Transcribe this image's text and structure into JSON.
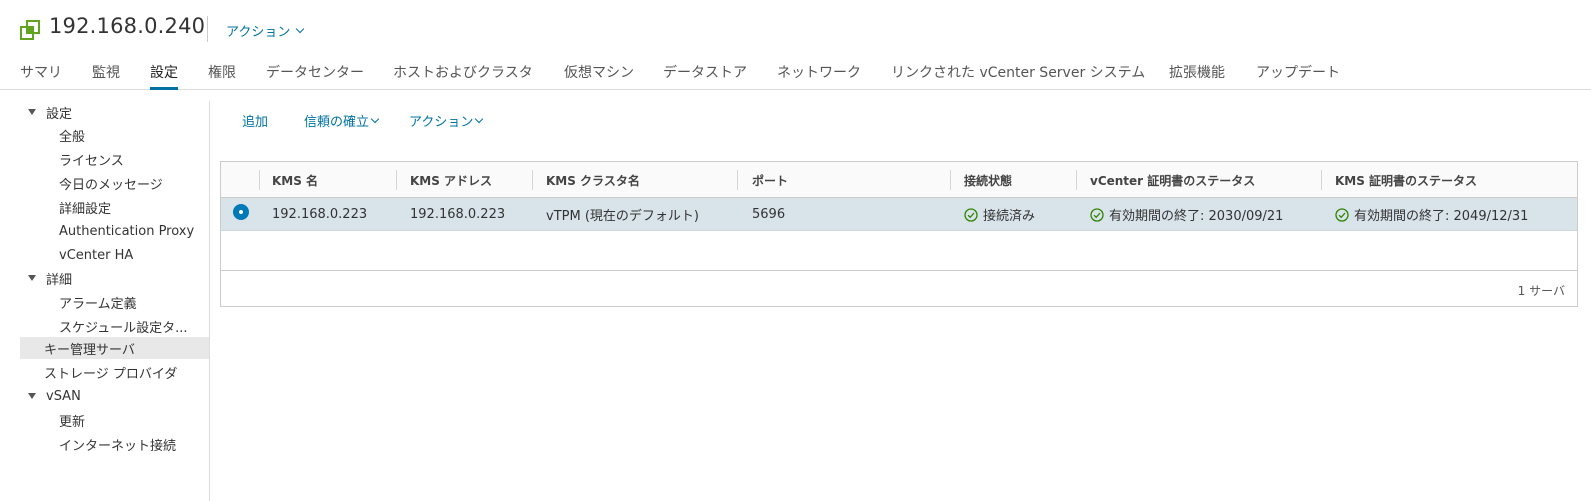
{
  "header": {
    "title": "192.168.0.240",
    "actions_label": "アクション",
    "icon": "host-icon",
    "accent": "#0072a3",
    "icon_color": "#62a420"
  },
  "tabs": [
    {
      "label": "サマリ"
    },
    {
      "label": "監視"
    },
    {
      "label": "設定"
    },
    {
      "label": "権限"
    },
    {
      "label": "データセンター"
    },
    {
      "label": "ホストおよびクラスタ"
    },
    {
      "label": "仮想マシン"
    },
    {
      "label": "データストア"
    },
    {
      "label": "ネットワーク"
    },
    {
      "label": "リンクされた vCenter Server システム"
    },
    {
      "label": "拡張機能"
    },
    {
      "label": "アップデート"
    }
  ],
  "active_tab": "設定",
  "sidebar": {
    "items": [
      {
        "label": "設定"
      },
      {
        "label": "全般"
      },
      {
        "label": "ライセンス"
      },
      {
        "label": "今日のメッセージ"
      },
      {
        "label": "詳細設定"
      },
      {
        "label": "Authentication Proxy"
      },
      {
        "label": "vCenter HA"
      },
      {
        "label": "詳細"
      },
      {
        "label": "アラーム定義"
      },
      {
        "label": "スケジュール設定タ..."
      },
      {
        "label": "キー管理サーバ"
      },
      {
        "label": "ストレージ プロバイダ"
      },
      {
        "label": "vSAN"
      },
      {
        "label": "更新"
      },
      {
        "label": "インターネット接続"
      }
    ],
    "selected": "キー管理サーバ"
  },
  "toolbar": {
    "add_label": "追加",
    "trust_label": "信頼の確立",
    "actions_label": "アクション"
  },
  "grid": {
    "columns": [
      "KMS 名",
      "KMS アドレス",
      "KMS クラスタ名",
      "ポート",
      "接続状態",
      "vCenter 証明書のステータス",
      "KMS 証明書のステータス"
    ],
    "rows": [
      {
        "name": "192.168.0.223",
        "address": "192.168.0.223",
        "cluster": "vTPM (現在のデフォルト)",
        "port": "5696",
        "status": "接続済み",
        "vc_cert": "有効期間の終了: 2030/09/21",
        "kms_cert": "有効期間の終了: 2049/12/31"
      }
    ],
    "footer": "1 サーバ",
    "status_color": "#2f8400",
    "selected_row_color": "#d8e3ea"
  }
}
